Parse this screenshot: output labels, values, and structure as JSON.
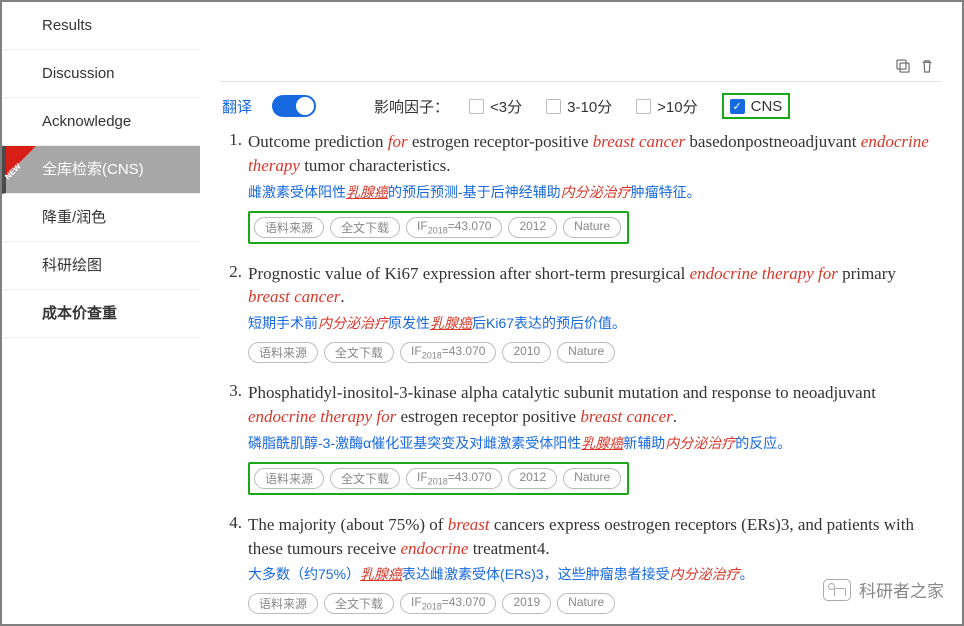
{
  "sidebar": {
    "items": [
      {
        "label": "Results",
        "active": false
      },
      {
        "label": "Discussion",
        "active": false
      },
      {
        "label": "Acknowledge",
        "active": false
      },
      {
        "label": "全库检索(CNS)",
        "active": true,
        "badge": "NEW"
      },
      {
        "label": "降重/润色",
        "active": false
      },
      {
        "label": "科研绘图",
        "active": false
      },
      {
        "label": "成本价查重",
        "active": false,
        "bold": true
      }
    ]
  },
  "filters": {
    "translate_label": "翻译",
    "translate_on": true,
    "impact_label": "影响因子：",
    "opts": [
      {
        "label": "<3分",
        "checked": false
      },
      {
        "label": "3-10分",
        "checked": false
      },
      {
        "label": ">10分",
        "checked": false
      },
      {
        "label": "CNS",
        "checked": true,
        "highlight": true
      }
    ]
  },
  "tags_common": {
    "source": "语料来源",
    "download": "全文下载",
    "if_prefix": "IF",
    "if_year": "2018",
    "if_value": "=43.070",
    "journal": "Nature"
  },
  "results": [
    {
      "num": "1.",
      "title_html": "Outcome prediction <span class='kw'>for</span> estrogen receptor-positive <span class='kw'>breast cancer</span> basedonpostneoadjuvant <span class='kw'>endocrine therapy</span> tumor characteristics.",
      "trans_html": "雌激素受体阳性<span class='kw-cn-u'>乳腺癌</span>的预后预测-基于后神经辅助<span class='kw-cn'>内分泌治疗</span>肿瘤特征。",
      "year": "2012",
      "highlight_tags": true
    },
    {
      "num": "2.",
      "title_html": "Prognostic value of Ki67 expression after short-term presurgical <span class='kw'>endocrine therapy for</span> primary <span class='kw'>breast cancer</span>.",
      "trans_html": "短期手术前<span class='kw-cn'>内分泌治疗</span>原发性<span class='kw-cn-u'>乳腺癌</span>后Ki67表达的预后价值。",
      "year": "2010",
      "highlight_tags": false
    },
    {
      "num": "3.",
      "title_html": "Phosphatidyl-inositol-3-kinase alpha catalytic subunit mutation and response to neoadjuvant <span class='kw'>endocrine therapy for</span> estrogen receptor positive <span class='kw'>breast cancer</span>.",
      "trans_html": "磷脂酰肌醇-3-激酶α催化亚基突变及对雌激素受体阳性<span class='kw-cn-u'>乳腺癌</span>新辅助<span class='kw-cn'>内分泌治疗</span>的反应。",
      "year": "2012",
      "highlight_tags": true
    },
    {
      "num": "4.",
      "title_html": "The majority (about 75%) of <span class='kw'>breast</span> cancers express oestrogen receptors (ERs)3, and patients with these tumours receive <span class='kw'>endocrine</span> treatment4.",
      "trans_html": "大多数（约75%）<span class='kw-cn-u'>乳腺癌</span>表达雌激素受体(ERs)3，这些肿瘤患者接受<span class='kw-cn'>内分泌治疗</span>。",
      "year": "2019",
      "highlight_tags": false
    }
  ],
  "watermark": "科研者之家"
}
